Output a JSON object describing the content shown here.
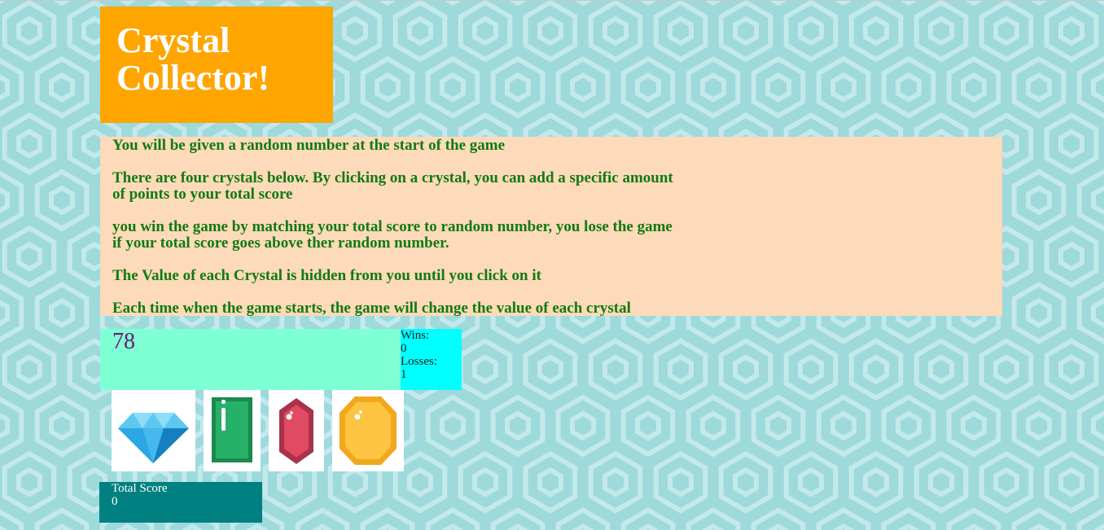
{
  "title": "Crystal Collector!",
  "instructions": [
    "You will be given a random number at the start of the game",
    "There are four crystals below. By clicking on a crystal, you can add a specific amount of points to your total score",
    "you win the game by matching your total score to random number, you lose the game if your total score goes above ther random number.",
    "The Value of each Crystal is hidden from you until you click on it",
    "Each time when the game starts, the game will change the value of each crystal"
  ],
  "target_number": "78",
  "stats": {
    "wins_label": "Wins:",
    "wins_value": "0",
    "losses_label": "Losses:",
    "losses_value": "1"
  },
  "crystals": [
    {
      "icon": "blue-diamond-icon"
    },
    {
      "icon": "green-emerald-icon"
    },
    {
      "icon": "red-ruby-icon"
    },
    {
      "icon": "yellow-topaz-icon"
    }
  ],
  "total_score": {
    "label": "Total Score",
    "value": "0"
  },
  "colors": {
    "background": "#9ed9dc",
    "pattern": "#c3e9eb",
    "title_bg": "#ffa500",
    "instructions_bg": "#fddab9",
    "instructions_text": "#127a12",
    "target_bg": "#7fffd4",
    "target_text": "#6a1b6f",
    "stats_bg": "#00ffff",
    "score_bg": "#008080"
  }
}
